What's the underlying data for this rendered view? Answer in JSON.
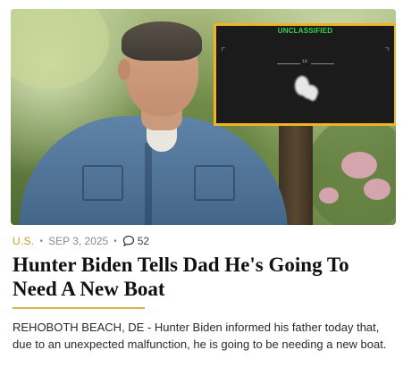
{
  "article": {
    "category": "U.S.",
    "date": "SEP 3, 2025",
    "comment_count": "52",
    "title": "Hunter Biden Tells Dad He's Going To Need A New Boat",
    "excerpt": "REHOBOTH BEACH, DE - Hunter Biden informed his father today that, due to an unexpected malfunction, he is going to be needing a new boat."
  },
  "inset": {
    "label": "UNCLASSIFIED",
    "reticle_value": "16"
  },
  "colors": {
    "category": "#d69b24",
    "rule": "#e0b24a",
    "inset_border": "#f0b323",
    "inset_label": "#31d64a"
  },
  "icons": {
    "comment": "speech-bubble-icon"
  }
}
